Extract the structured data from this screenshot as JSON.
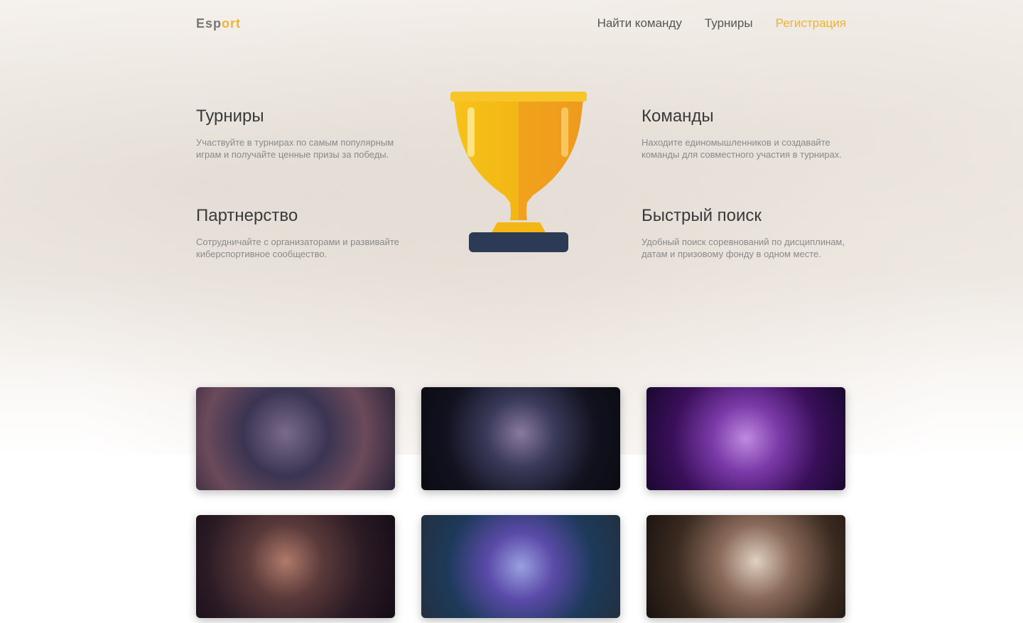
{
  "header": {
    "logo_main": "Esp",
    "logo_accent": "ort",
    "nav": [
      {
        "label": "Найти команду"
      },
      {
        "label": "Турниры"
      },
      {
        "label": "Регистрация"
      }
    ]
  },
  "features": [
    {
      "title": "Турниры",
      "text": "Участвуйте в турнирах по самым популярным играм и получайте ценные призы за победы."
    },
    {
      "title": "Команды",
      "text": "Находите единомышленников и создавайте команды для совместного участия в турнирах."
    },
    {
      "title": "Партнерство",
      "text": "Сотрудничайте с организаторами и развивайте киберспортивное сообщество."
    },
    {
      "title": "Быстрый поиск",
      "text": "Удобный поиск соревнований по дисциплинам, датам и призовому фонду в одном месте."
    }
  ],
  "games": [
    {
      "name": "",
      "colors": [
        "#3b3552",
        "#6b4a5a",
        "#2a2338"
      ]
    },
    {
      "name": "",
      "colors": [
        "#0d0d18",
        "#3a3a5a",
        "#0b0b12"
      ]
    },
    {
      "name": "",
      "colors": [
        "#3a0f5a",
        "#7a3aa8",
        "#1a0830"
      ]
    },
    {
      "name": "",
      "colors": [
        "#1f1420",
        "#5a3a3a",
        "#140c16"
      ]
    },
    {
      "name": "",
      "colors": [
        "#1d3a5a",
        "#5a4aa8",
        "#223040"
      ]
    },
    {
      "name": "",
      "colors": [
        "#2a1a14",
        "#8a6a5a",
        "#1a1210"
      ]
    }
  ],
  "colors": {
    "accent": "#f2b22a",
    "trophy_base": "#2d3a55"
  },
  "icons": {
    "trophy": "trophy-icon"
  }
}
